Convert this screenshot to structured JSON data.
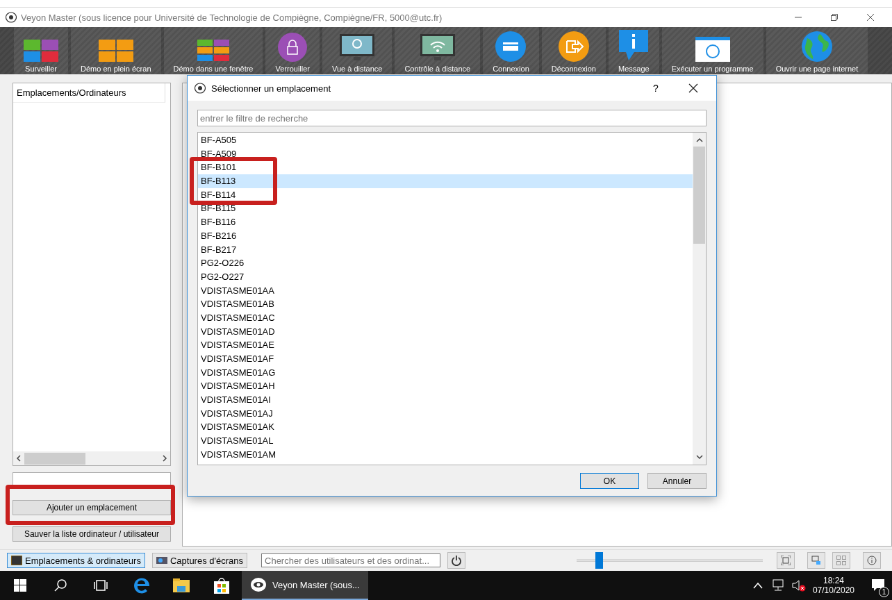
{
  "window": {
    "title": "Veyon Master (sous licence pour Université de Technologie de Compiègne, Compiègne/FR, 5000@utc.fr)"
  },
  "toolbar": [
    {
      "label": "Surveiller",
      "kind": "grid"
    },
    {
      "label": "Démo en plein écran",
      "kind": "fullscreen"
    },
    {
      "label": "Démo dans une fenêtre",
      "kind": "window"
    },
    {
      "label": "Verrouiller",
      "kind": "lock"
    },
    {
      "label": "Vue à distance",
      "kind": "view"
    },
    {
      "label": "Contrôle à distance",
      "kind": "control"
    },
    {
      "label": "Connexion",
      "kind": "login"
    },
    {
      "label": "Déconnexion",
      "kind": "logout"
    },
    {
      "label": "Message",
      "kind": "message"
    },
    {
      "label": "Exécuter un programme",
      "kind": "program"
    },
    {
      "label": "Ouvrir une page internet",
      "kind": "web"
    }
  ],
  "sidebar": {
    "header": "Emplacements/Ordinateurs",
    "buttons": [
      {
        "label": "Ajouter un emplacement",
        "highlighted": true
      },
      {
        "label": "Sauver la liste ordinateur / utilisateur",
        "highlighted": false
      }
    ]
  },
  "dialog": {
    "title": "Sélectionner un emplacement",
    "help": "?",
    "filter": {
      "placeholder": "entrer le filtre de recherche"
    },
    "items": [
      {
        "label": "BF-A505",
        "selected": false,
        "highlighted": false
      },
      {
        "label": "BF-A509",
        "selected": false,
        "highlighted": false
      },
      {
        "label": "BF-B101",
        "selected": false,
        "highlighted": true
      },
      {
        "label": "BF-B113",
        "selected": true,
        "highlighted": true
      },
      {
        "label": "BF-B114",
        "selected": false,
        "highlighted": true
      },
      {
        "label": "BF-B115",
        "selected": false
      },
      {
        "label": "BF-B116",
        "selected": false
      },
      {
        "label": "BF-B216",
        "selected": false
      },
      {
        "label": "BF-B217",
        "selected": false
      },
      {
        "label": "PG2-O226",
        "selected": false
      },
      {
        "label": "PG2-O227",
        "selected": false
      },
      {
        "label": "VDISTASME01AA",
        "selected": false
      },
      {
        "label": "VDISTASME01AB",
        "selected": false
      },
      {
        "label": "VDISTASME01AC",
        "selected": false
      },
      {
        "label": "VDISTASME01AD",
        "selected": false
      },
      {
        "label": "VDISTASME01AE",
        "selected": false
      },
      {
        "label": "VDISTASME01AF",
        "selected": false
      },
      {
        "label": "VDISTASME01AG",
        "selected": false
      },
      {
        "label": "VDISTASME01AH",
        "selected": false
      },
      {
        "label": "VDISTASME01AI",
        "selected": false
      },
      {
        "label": "VDISTASME01AJ",
        "selected": false
      },
      {
        "label": "VDISTASME01AK",
        "selected": false
      },
      {
        "label": "VDISTASME01AL",
        "selected": false
      },
      {
        "label": "VDISTASME01AM",
        "selected": false
      }
    ],
    "buttons": [
      "OK",
      "Annuler"
    ]
  },
  "bottom_bar": {
    "tabs": [
      {
        "label": "Emplacements & ordinateurs",
        "selected": true
      },
      {
        "label": "Captures d'écrans",
        "selected": false
      }
    ],
    "search": {
      "placeholder": "Chercher des utilisateurs et des ordinat..."
    },
    "zoom": {
      "level": 0.1
    }
  },
  "taskbar": {
    "app": "Veyon Master (sous...",
    "time": "18:24",
    "date": "07/10/2020",
    "notifications": "1"
  }
}
